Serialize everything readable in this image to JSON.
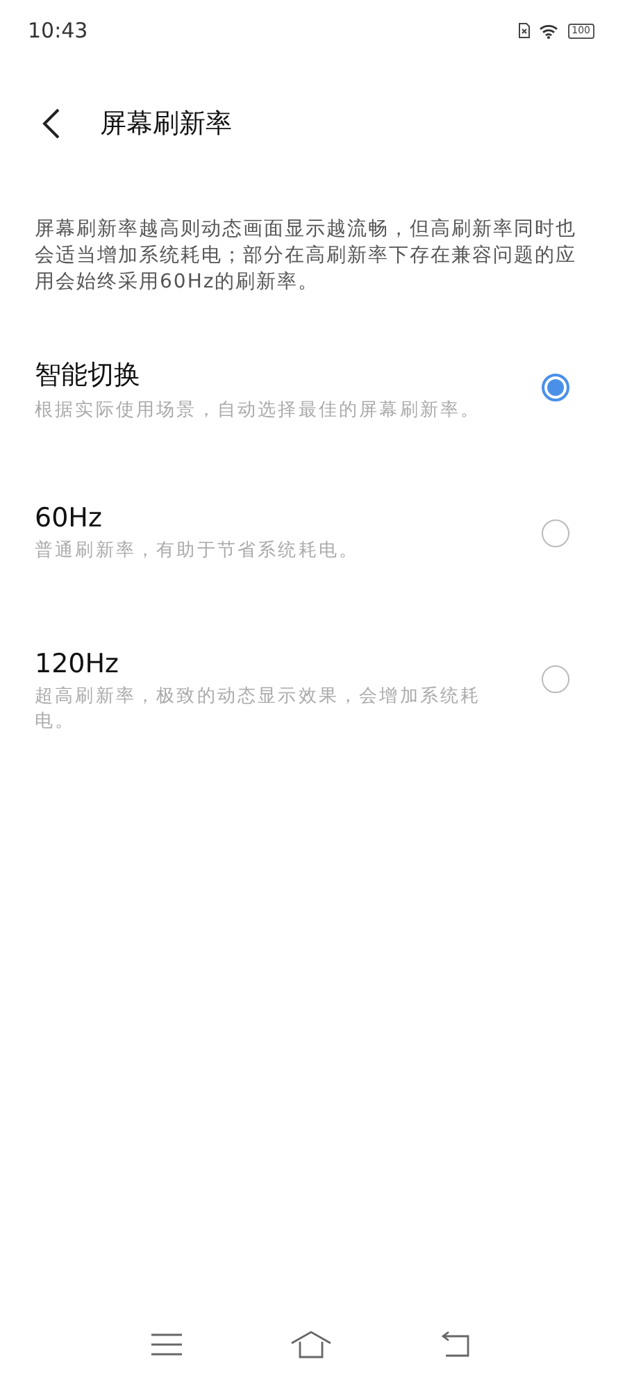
{
  "status_bar": {
    "time": "10:43",
    "battery": "100"
  },
  "header": {
    "title": "屏幕刷新率"
  },
  "description": "屏幕刷新率越高则动态画面显示越流畅，但高刷新率同时也会适当增加系统耗电；部分在高刷新率下存在兼容问题的应用会始终采用60Hz的刷新率。",
  "options": [
    {
      "title": "智能切换",
      "subtitle": "根据实际使用场景，自动选择最佳的屏幕刷新率。",
      "selected": true
    },
    {
      "title": "60Hz",
      "subtitle": "普通刷新率，有助于节省系统耗电。",
      "selected": false
    },
    {
      "title": "120Hz",
      "subtitle": "超高刷新率，极致的动态显示效果，会增加系统耗电。",
      "selected": false
    }
  ]
}
